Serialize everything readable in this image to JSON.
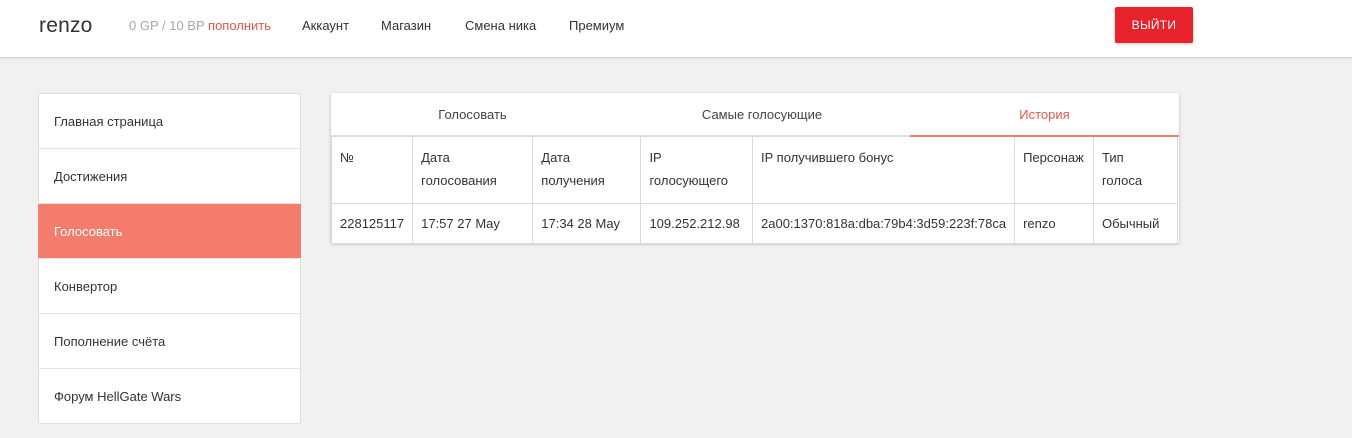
{
  "header": {
    "brand": "renzo",
    "balance": "0 GP / 10 BP",
    "topup_label": "пополнить",
    "nav": [
      "Аккаунт",
      "Магазин",
      "Смена ника",
      "Премиум"
    ],
    "logout_label": "ВЫЙТИ",
    "logout_color": "#e8222a"
  },
  "sidebar": {
    "items": [
      {
        "label": "Главная страница"
      },
      {
        "label": "Достижения"
      },
      {
        "label": "Голосовать",
        "active": true
      },
      {
        "label": "Конвертор"
      },
      {
        "label": "Пополнение счёта"
      },
      {
        "label": "Форум HellGate Wars"
      }
    ],
    "active_color": "#f47c6c"
  },
  "tabs": [
    {
      "label": "Голосовать"
    },
    {
      "label": "Самые голосующие"
    },
    {
      "label": "История",
      "active": true
    }
  ],
  "table": {
    "headers": [
      [
        "№"
      ],
      [
        "Дата",
        "голосования"
      ],
      [
        "Дата",
        "получения"
      ],
      [
        "IP",
        "голосующего"
      ],
      [
        "IP получившего бонус"
      ],
      [
        "Персонаж"
      ],
      [
        "Тип",
        "голоса"
      ]
    ],
    "rows": [
      [
        "228125117",
        "17:57 27 May",
        "17:34 28 May",
        "109.252.212.98",
        "2a00:1370:818a:dba:79b4:3d59:223f:78ca",
        "renzo",
        "Обычный"
      ]
    ]
  }
}
